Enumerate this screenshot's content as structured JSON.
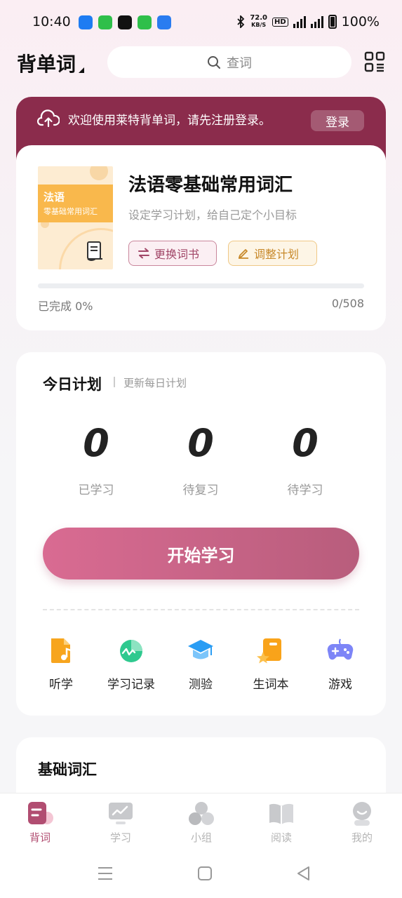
{
  "status_bar": {
    "time": "10:40",
    "net_speed_value": "72.0",
    "net_speed_unit": "KB/S",
    "hd": "HD",
    "battery": "100%",
    "app_colors": [
      "#1e7cf2",
      "#2fbf4a",
      "#111111",
      "#2fbf4a",
      "#2a7cf0"
    ]
  },
  "header": {
    "book_selector": "背单词",
    "search_placeholder": "查词"
  },
  "banner": {
    "message": "欢迎使用莱特背单词，请先注册登录。",
    "login_label": "登录"
  },
  "book": {
    "cover_title": "法语",
    "cover_subtitle": "零基础常用词汇",
    "title": "法语零基础常用词汇",
    "subtitle": "设定学习计划，给自己定个小目标",
    "change_book_label": "更换词书",
    "adjust_plan_label": "调整计划",
    "progress_label": "已完成 0%",
    "progress_count": "0/508",
    "progress_fraction": 0
  },
  "plan": {
    "title": "今日计划",
    "update_link": "更新每日计划",
    "stats": [
      {
        "value": "0",
        "label": "已学习"
      },
      {
        "value": "0",
        "label": "待复习"
      },
      {
        "value": "0",
        "label": "待学习"
      }
    ],
    "start_label": "开始学习",
    "tools": [
      {
        "label": "听学",
        "icon": "audio-file-icon"
      },
      {
        "label": "学习记录",
        "icon": "chart-record-icon"
      },
      {
        "label": "测验",
        "icon": "graduation-cap-icon"
      },
      {
        "label": "生词本",
        "icon": "star-notebook-icon"
      },
      {
        "label": "游戏",
        "icon": "gamepad-icon"
      }
    ]
  },
  "vocab": {
    "title": "基础词汇"
  },
  "tab_bar": {
    "tabs": [
      {
        "label": "背词",
        "icon": "flashcard-icon",
        "active": true
      },
      {
        "label": "学习",
        "icon": "monitor-icon",
        "active": false
      },
      {
        "label": "小组",
        "icon": "group-icon",
        "active": false
      },
      {
        "label": "阅读",
        "icon": "book-icon",
        "active": false
      },
      {
        "label": "我的",
        "icon": "profile-icon",
        "active": false
      }
    ]
  },
  "colors": {
    "brand": "#b14d71",
    "banner": "#8b2c4c",
    "accent_orange": "#f9b84c"
  }
}
